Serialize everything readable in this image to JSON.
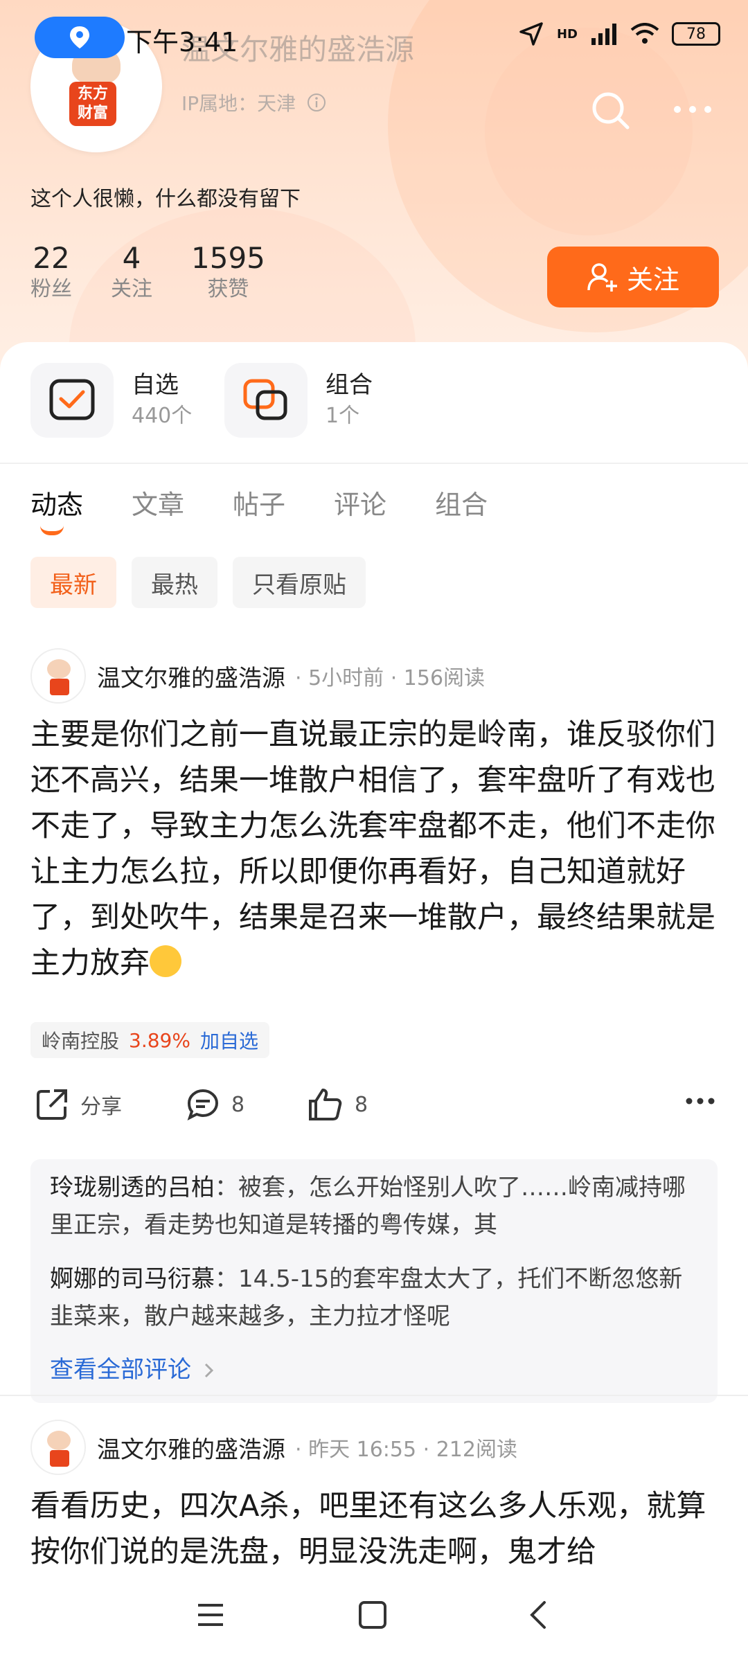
{
  "status_bar": {
    "time": "下午3:41",
    "battery": "78",
    "network": "HD"
  },
  "profile": {
    "name": "温文尔雅的盛浩源",
    "ip_location": "IP属地：天津",
    "bio": "这个人很懒，什么都没有留下",
    "avatar_logo_text": "东方财富",
    "stats": [
      {
        "value": "22",
        "label": "粉丝"
      },
      {
        "value": "4",
        "label": "关注"
      },
      {
        "value": "1595",
        "label": "获赞"
      }
    ],
    "follow_label": "关注"
  },
  "holdings": [
    {
      "title": "自选",
      "count": "440个"
    },
    {
      "title": "组合",
      "count": "1个"
    }
  ],
  "tabs": [
    "动态",
    "文章",
    "帖子",
    "评论",
    "组合"
  ],
  "filters": [
    "最新",
    "最热",
    "只看原贴"
  ],
  "posts": [
    {
      "author": "温文尔雅的盛浩源",
      "time": "5小时前",
      "reads": "156阅读",
      "body": "主要是你们之前一直说最正宗的是岭南，谁反驳你们还不高兴，结果一堆散户相信了，套牢盘听了有戏也不走了，导致主力怎么洗套牢盘都不走，他们不走你让主力怎么拉，所以即便你再看好，自己知道就好了，到处吹牛，结果是召来一堆散户，最终结果就是主力放弃",
      "stock": {
        "name": "岭南控股",
        "change": "3.89%",
        "add": "加自选"
      },
      "share_label": "分享",
      "comment_count": "8",
      "like_count": "8",
      "comments": [
        {
          "user": "玲珑剔透的吕柏",
          "text": "被套，怎么开始怪别人吹了……岭南减持哪里正宗，看走势也知道是转播的粤传媒，其"
        },
        {
          "user": "婀娜的司马衍慕",
          "text": "14.5-15的套牢盘太大了，托们不断忽悠新韭菜来，散户越来越多，主力拉才怪呢"
        }
      ],
      "view_all": "查看全部评论"
    },
    {
      "author": "温文尔雅的盛浩源",
      "time": "昨天 16:55",
      "reads": "212阅读",
      "body": "看看历史，四次A杀，吧里还有这么多人乐观，就算按你们说的是洗盘，明显没洗走啊，鬼才给"
    }
  ],
  "colors": {
    "accent": "#ff6a1a",
    "link": "#2a6ad6",
    "stock_up": "#e8451c"
  }
}
